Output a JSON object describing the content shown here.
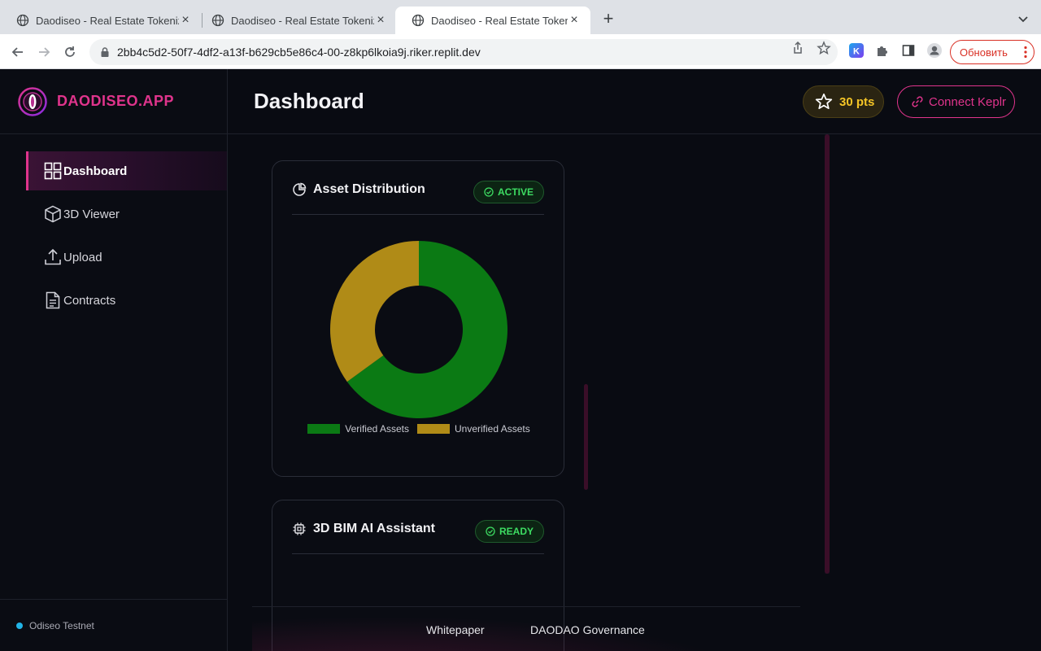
{
  "browser": {
    "tabs": [
      {
        "title": "Daodiseo - Real Estate Tokeniz"
      },
      {
        "title": "Daodiseo - Real Estate Tokeniz"
      },
      {
        "title": "Daodiseo - Real Estate Tokeniz"
      }
    ],
    "new_tab_label": "+",
    "url": "2bb4c5d2-50f7-4df2-a13f-b629cb5e86c4-00-z8kp6lkoia9j.riker.replit.dev",
    "extension_k_label": "K",
    "update_label": "Обновить"
  },
  "sidebar": {
    "brand": "DAODISEO.APP",
    "items": [
      {
        "label": "Dashboard",
        "icon": "grid-icon",
        "active": true
      },
      {
        "label": "3D Viewer",
        "icon": "cube-icon"
      },
      {
        "label": "Upload",
        "icon": "upload-icon"
      },
      {
        "label": "Contracts",
        "icon": "document-icon"
      }
    ],
    "network": "Odiseo Testnet"
  },
  "header": {
    "title": "Dashboard",
    "points": "30 pts",
    "connect_label": "Connect Keplr"
  },
  "cards": {
    "asset_distribution": {
      "title": "Asset Distribution",
      "status": "ACTIVE"
    },
    "bim_assistant": {
      "title": "3D BIM AI Assistant",
      "status": "READY"
    }
  },
  "chart_data": {
    "type": "pie",
    "categories": [
      "Verified Assets",
      "Unverified Assets"
    ],
    "values": [
      65,
      35
    ],
    "colors": [
      "#0b7a14",
      "#b08b17"
    ],
    "legend_placement": "bottom"
  },
  "footer": {
    "links": [
      "Whitepaper",
      "DAODAO Governance"
    ]
  },
  "colors": {
    "accent": "#e0348c",
    "points": "#f5c526",
    "status_green": "#3ddc62"
  }
}
